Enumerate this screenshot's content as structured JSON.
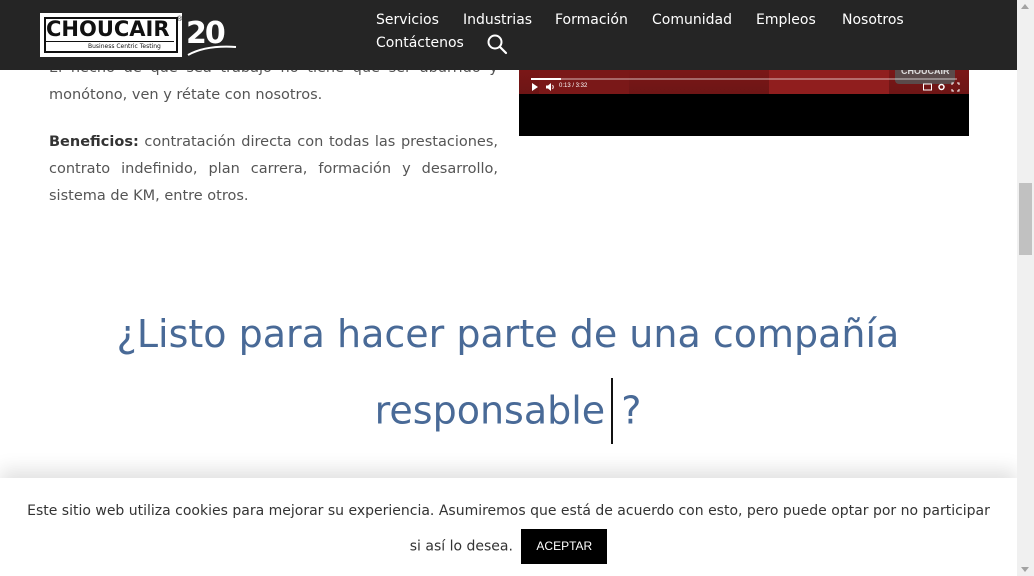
{
  "header": {
    "logo": {
      "name": "CHOUCAIR",
      "tagline": "Business Centric Testing",
      "anniversary": "20"
    },
    "nav": [
      {
        "label": "Servicios"
      },
      {
        "label": "Industrias"
      },
      {
        "label": "Formación"
      },
      {
        "label": "Comunidad"
      },
      {
        "label": "Empleos"
      },
      {
        "label": "Nosotros"
      },
      {
        "label": "Contáctenos"
      }
    ],
    "search_icon": "search-icon"
  },
  "content": {
    "paragraph1": "El hecho de que sea trabajo no tiene que ser aburrido y monótono, ven y rétate con nosotros.",
    "paragraph2_label": "Beneficios:",
    "paragraph2_text": " contratación directa con todas las prestaciones, contrato indefinido,  plan carrera, formación y desarrollo, sistema de KM, entre otros."
  },
  "video": {
    "time": "0:13 / 3:32",
    "progress": 0.07,
    "watermark": "CHOUCAIR"
  },
  "cta": {
    "line1": "¿Listo para hacer parte de una compañía",
    "line2_word": "responsable",
    "line2_end": "?"
  },
  "cookie": {
    "text": "Este sitio web utiliza cookies para mejorar su experiencia. Asumiremos que está de acuerdo con esto, pero puede optar por no participar si así lo desea.",
    "accept_label": "ACEPTAR"
  },
  "colors": {
    "header_bg": "#252525",
    "heading": "#496a97",
    "accept_bg": "#000000"
  }
}
